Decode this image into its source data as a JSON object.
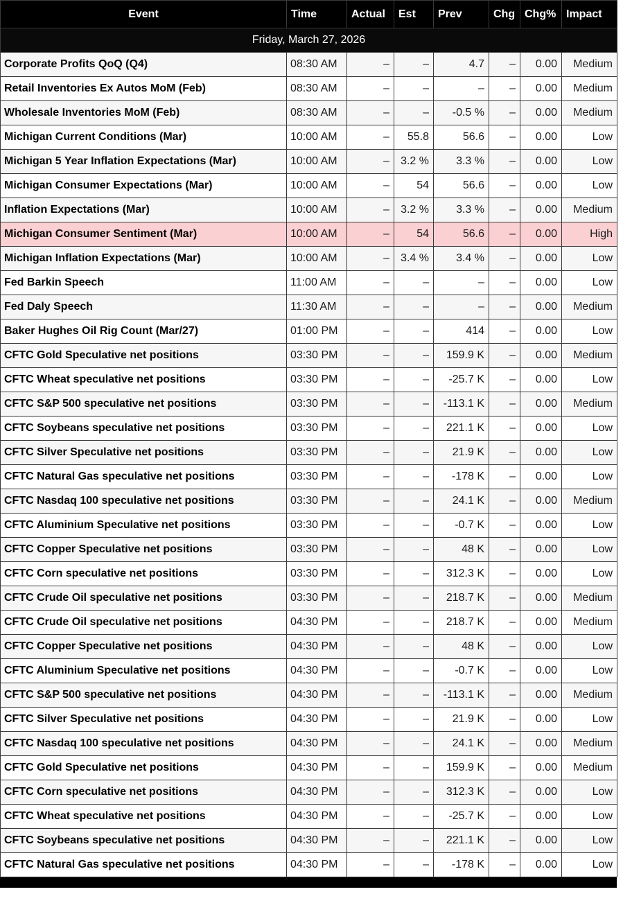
{
  "date_header": "Friday, March 27, 2026",
  "columns": [
    "Event",
    "Time",
    "Actual",
    "Est",
    "Prev",
    "Chg",
    "Chg%",
    "Impact"
  ],
  "colors": {
    "header_bg": "#000000",
    "date_bg": "#0a0a0a",
    "row_bg": "#ffffff",
    "row_alt_bg": "#f6f6f6",
    "highlight_bg": "#fbd0d2",
    "border": "#3a3a3a",
    "header_text": "#ffffff",
    "text": "#1b1b1b"
  },
  "rows": [
    {
      "event": "Corporate Profits QoQ (Q4)",
      "time": "08:30 AM",
      "actual": "–",
      "est": "–",
      "prev": "4.7",
      "chg": "–",
      "chg_pct": "0.00",
      "impact": "Medium",
      "highlight": false
    },
    {
      "event": "Retail Inventories Ex Autos MoM (Feb)",
      "time": "08:30 AM",
      "actual": "–",
      "est": "–",
      "prev": "–",
      "chg": "–",
      "chg_pct": "0.00",
      "impact": "Medium",
      "highlight": false
    },
    {
      "event": "Wholesale Inventories MoM (Feb)",
      "time": "08:30 AM",
      "actual": "–",
      "est": "–",
      "prev": "-0.5 %",
      "chg": "–",
      "chg_pct": "0.00",
      "impact": "Medium",
      "highlight": false
    },
    {
      "event": "Michigan Current Conditions (Mar)",
      "time": "10:00 AM",
      "actual": "–",
      "est": "55.8",
      "prev": "56.6",
      "chg": "–",
      "chg_pct": "0.00",
      "impact": "Low",
      "highlight": false
    },
    {
      "event": "Michigan 5 Year Inflation Expectations (Mar)",
      "time": "10:00 AM",
      "actual": "–",
      "est": "3.2 %",
      "prev": "3.3 %",
      "chg": "–",
      "chg_pct": "0.00",
      "impact": "Low",
      "highlight": false
    },
    {
      "event": "Michigan Consumer Expectations (Mar)",
      "time": "10:00 AM",
      "actual": "–",
      "est": "54",
      "prev": "56.6",
      "chg": "–",
      "chg_pct": "0.00",
      "impact": "Low",
      "highlight": false
    },
    {
      "event": "Inflation Expectations (Mar)",
      "time": "10:00 AM",
      "actual": "–",
      "est": "3.2 %",
      "prev": "3.3 %",
      "chg": "–",
      "chg_pct": "0.00",
      "impact": "Medium",
      "highlight": false
    },
    {
      "event": "Michigan Consumer Sentiment (Mar)",
      "time": "10:00 AM",
      "actual": "–",
      "est": "54",
      "prev": "56.6",
      "chg": "–",
      "chg_pct": "0.00",
      "impact": "High",
      "highlight": true
    },
    {
      "event": "Michigan Inflation Expectations (Mar)",
      "time": "10:00 AM",
      "actual": "–",
      "est": "3.4 %",
      "prev": "3.4 %",
      "chg": "–",
      "chg_pct": "0.00",
      "impact": "Low",
      "highlight": false
    },
    {
      "event": "Fed Barkin Speech",
      "time": "11:00 AM",
      "actual": "–",
      "est": "–",
      "prev": "–",
      "chg": "–",
      "chg_pct": "0.00",
      "impact": "Low",
      "highlight": false
    },
    {
      "event": "Fed Daly Speech",
      "time": "11:30 AM",
      "actual": "–",
      "est": "–",
      "prev": "–",
      "chg": "–",
      "chg_pct": "0.00",
      "impact": "Medium",
      "highlight": false
    },
    {
      "event": "Baker Hughes Oil Rig Count (Mar/27)",
      "time": "01:00 PM",
      "actual": "–",
      "est": "–",
      "prev": "414",
      "chg": "–",
      "chg_pct": "0.00",
      "impact": "Low",
      "highlight": false
    },
    {
      "event": "CFTC Gold Speculative net positions",
      "time": "03:30 PM",
      "actual": "–",
      "est": "–",
      "prev": "159.9 K",
      "chg": "–",
      "chg_pct": "0.00",
      "impact": "Medium",
      "highlight": false
    },
    {
      "event": "CFTC Wheat speculative net positions",
      "time": "03:30 PM",
      "actual": "–",
      "est": "–",
      "prev": "-25.7 K",
      "chg": "–",
      "chg_pct": "0.00",
      "impact": "Low",
      "highlight": false
    },
    {
      "event": "CFTC S&P 500 speculative net positions",
      "time": "03:30 PM",
      "actual": "–",
      "est": "–",
      "prev": "-113.1 K",
      "chg": "–",
      "chg_pct": "0.00",
      "impact": "Medium",
      "highlight": false
    },
    {
      "event": "CFTC Soybeans speculative net positions",
      "time": "03:30 PM",
      "actual": "–",
      "est": "–",
      "prev": "221.1 K",
      "chg": "–",
      "chg_pct": "0.00",
      "impact": "Low",
      "highlight": false
    },
    {
      "event": "CFTC Silver Speculative net positions",
      "time": "03:30 PM",
      "actual": "–",
      "est": "–",
      "prev": "21.9 K",
      "chg": "–",
      "chg_pct": "0.00",
      "impact": "Low",
      "highlight": false
    },
    {
      "event": "CFTC Natural Gas speculative net positions",
      "time": "03:30 PM",
      "actual": "–",
      "est": "–",
      "prev": "-178 K",
      "chg": "–",
      "chg_pct": "0.00",
      "impact": "Low",
      "highlight": false
    },
    {
      "event": "CFTC Nasdaq 100 speculative net positions",
      "time": "03:30 PM",
      "actual": "–",
      "est": "–",
      "prev": "24.1 K",
      "chg": "–",
      "chg_pct": "0.00",
      "impact": "Medium",
      "highlight": false
    },
    {
      "event": "CFTC Aluminium Speculative net positions",
      "time": "03:30 PM",
      "actual": "–",
      "est": "–",
      "prev": "-0.7 K",
      "chg": "–",
      "chg_pct": "0.00",
      "impact": "Low",
      "highlight": false
    },
    {
      "event": "CFTC Copper Speculative net positions",
      "time": "03:30 PM",
      "actual": "–",
      "est": "–",
      "prev": "48 K",
      "chg": "–",
      "chg_pct": "0.00",
      "impact": "Low",
      "highlight": false
    },
    {
      "event": "CFTC Corn speculative net positions",
      "time": "03:30 PM",
      "actual": "–",
      "est": "–",
      "prev": "312.3 K",
      "chg": "–",
      "chg_pct": "0.00",
      "impact": "Low",
      "highlight": false
    },
    {
      "event": "CFTC Crude Oil speculative net positions",
      "time": "03:30 PM",
      "actual": "–",
      "est": "–",
      "prev": "218.7 K",
      "chg": "–",
      "chg_pct": "0.00",
      "impact": "Medium",
      "highlight": false
    },
    {
      "event": "CFTC Crude Oil speculative net positions",
      "time": "04:30 PM",
      "actual": "–",
      "est": "–",
      "prev": "218.7 K",
      "chg": "–",
      "chg_pct": "0.00",
      "impact": "Medium",
      "highlight": false
    },
    {
      "event": "CFTC Copper Speculative net positions",
      "time": "04:30 PM",
      "actual": "–",
      "est": "–",
      "prev": "48 K",
      "chg": "–",
      "chg_pct": "0.00",
      "impact": "Low",
      "highlight": false
    },
    {
      "event": "CFTC Aluminium Speculative net positions",
      "time": "04:30 PM",
      "actual": "–",
      "est": "–",
      "prev": "-0.7 K",
      "chg": "–",
      "chg_pct": "0.00",
      "impact": "Low",
      "highlight": false
    },
    {
      "event": "CFTC S&P 500 speculative net positions",
      "time": "04:30 PM",
      "actual": "–",
      "est": "–",
      "prev": "-113.1 K",
      "chg": "–",
      "chg_pct": "0.00",
      "impact": "Medium",
      "highlight": false
    },
    {
      "event": "CFTC Silver Speculative net positions",
      "time": "04:30 PM",
      "actual": "–",
      "est": "–",
      "prev": "21.9 K",
      "chg": "–",
      "chg_pct": "0.00",
      "impact": "Low",
      "highlight": false
    },
    {
      "event": "CFTC Nasdaq 100 speculative net positions",
      "time": "04:30 PM",
      "actual": "–",
      "est": "–",
      "prev": "24.1 K",
      "chg": "–",
      "chg_pct": "0.00",
      "impact": "Medium",
      "highlight": false
    },
    {
      "event": "CFTC Gold Speculative net positions",
      "time": "04:30 PM",
      "actual": "–",
      "est": "–",
      "prev": "159.9 K",
      "chg": "–",
      "chg_pct": "0.00",
      "impact": "Medium",
      "highlight": false
    },
    {
      "event": "CFTC Corn speculative net positions",
      "time": "04:30 PM",
      "actual": "–",
      "est": "–",
      "prev": "312.3 K",
      "chg": "–",
      "chg_pct": "0.00",
      "impact": "Low",
      "highlight": false
    },
    {
      "event": "CFTC Wheat speculative net positions",
      "time": "04:30 PM",
      "actual": "–",
      "est": "–",
      "prev": "-25.7 K",
      "chg": "–",
      "chg_pct": "0.00",
      "impact": "Low",
      "highlight": false
    },
    {
      "event": "CFTC Soybeans speculative net positions",
      "time": "04:30 PM",
      "actual": "–",
      "est": "–",
      "prev": "221.1 K",
      "chg": "–",
      "chg_pct": "0.00",
      "impact": "Low",
      "highlight": false
    },
    {
      "event": "CFTC Natural Gas speculative net positions",
      "time": "04:30 PM",
      "actual": "–",
      "est": "–",
      "prev": "-178 K",
      "chg": "–",
      "chg_pct": "0.00",
      "impact": "Low",
      "highlight": false
    }
  ]
}
